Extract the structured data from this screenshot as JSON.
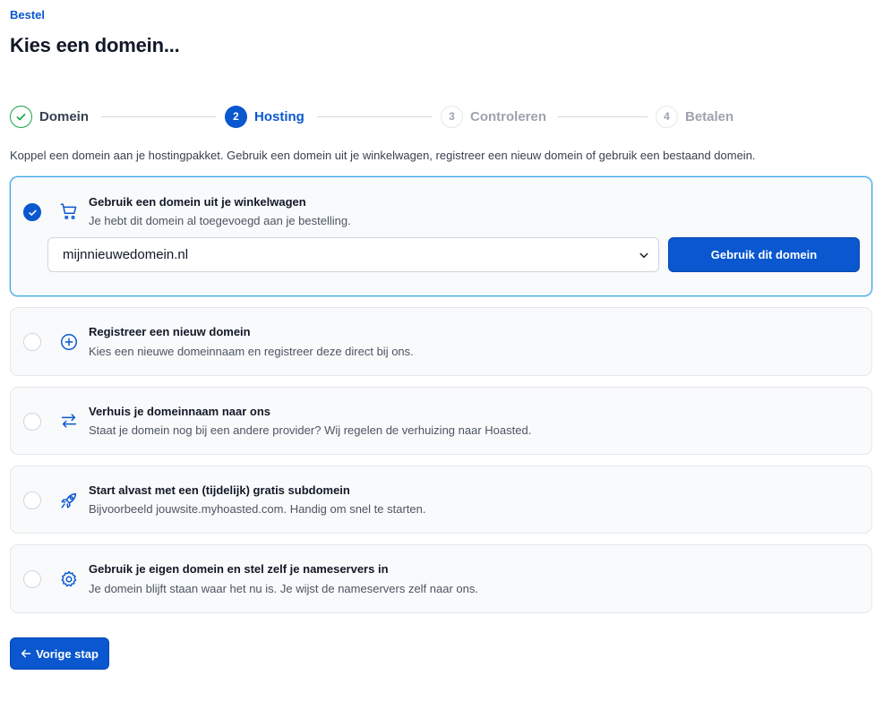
{
  "breadcrumb": "Bestel",
  "page_title": "Kies een domein...",
  "stepper": {
    "steps": [
      {
        "number": "1",
        "label": "Domein",
        "state": "done"
      },
      {
        "number": "2",
        "label": "Hosting",
        "state": "active"
      },
      {
        "number": "3",
        "label": "Controleren",
        "state": "todo"
      },
      {
        "number": "4",
        "label": "Betalen",
        "state": "todo"
      }
    ]
  },
  "intro": "Koppel een domein aan je hostingpakket. Gebruik een domein uit je winkelwagen, registreer een nieuw domein of gebruik een bestaand domein.",
  "options": [
    {
      "title": "Gebruik een domein uit je winkelwagen",
      "description": "Je hebt dit domein al toegevoegd aan je bestelling.",
      "icon": "cart-icon",
      "selected": true
    },
    {
      "title": "Registreer een nieuw domein",
      "description": "Kies een nieuwe domeinnaam en registreer deze direct bij ons.",
      "icon": "plus-circle-icon",
      "selected": false
    },
    {
      "title": "Verhuis je domeinnaam naar ons",
      "description": "Staat je domein nog bij een andere provider? Wij regelen de verhuizing naar Hoasted.",
      "icon": "transfer-arrows-icon",
      "selected": false
    },
    {
      "title": "Start alvast met een (tijdelijk) gratis subdomein",
      "description": "Bijvoorbeeld jouwsite.myhoasted.com. Handig om snel te starten.",
      "icon": "rocket-icon",
      "selected": false
    },
    {
      "title": "Gebruik je eigen domein en stel zelf je nameservers in",
      "description": "Je domein blijft staan waar het nu is. Je wijst de nameservers zelf naar ons.",
      "icon": "gear-icon",
      "selected": false
    }
  ],
  "cart_domain": {
    "selected_value": "mijnnieuwedomein.nl",
    "button_label": "Gebruik dit domein"
  },
  "back_button": "Vorige stap",
  "colors": {
    "primary": "#0a57cf",
    "success": "#16a34a",
    "selected_border": "#3ba6e9"
  }
}
